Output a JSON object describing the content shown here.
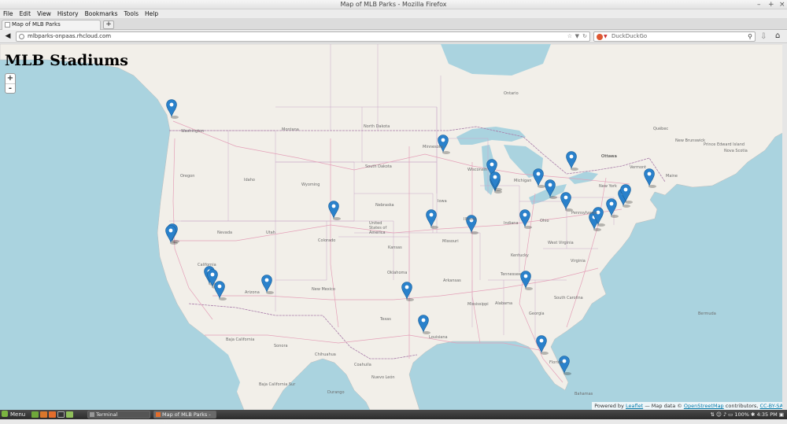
{
  "window": {
    "title": "Map of MLB Parks - Mozilla Firefox"
  },
  "menu": [
    "File",
    "Edit",
    "View",
    "History",
    "Bookmarks",
    "Tools",
    "Help"
  ],
  "tab": {
    "title": "Map of MLB Parks",
    "new_tab": "+"
  },
  "nav": {
    "url": "mlbparks-onpaas.rhcloud.com",
    "search_placeholder": "DuckDuckGo"
  },
  "page": {
    "title": "MLB Stadiums"
  },
  "zoom": {
    "in": "+",
    "out": "-"
  },
  "attribution": {
    "powered_by": "Powered by",
    "leaflet": "Leaflet",
    "sep": "— Map data ©",
    "osm": "OpenStreetMap",
    "contributors": "contributors,",
    "license": "CC-BY-SA"
  },
  "map_labels": [
    "Montana",
    "North Dakota",
    "South Dakota",
    "Wyoming",
    "Idaho",
    "Oregon",
    "Washington",
    "Nevada",
    "Utah",
    "Colorado",
    "Nebraska",
    "Kansas",
    "California",
    "Arizona",
    "New Mexico",
    "Texas",
    "Oklahoma",
    "Minnesota",
    "Wisconsin",
    "Iowa",
    "Missouri",
    "Arkansas",
    "Mississippi",
    "Alabama",
    "Tennessee",
    "Kentucky",
    "Indiana",
    "Ohio",
    "Michigan",
    "Pennsylvania",
    "New York",
    "Virginia",
    "South Carolina",
    "Georgia",
    "Florida",
    "Ontario",
    "Ottawa",
    "Québec",
    "Maine",
    "Vermont",
    "United States of America",
    "Sonora",
    "Chihuahua",
    "Coahuila",
    "Durango",
    "Nuevo León",
    "Baja California",
    "Baja California Sur",
    "Bermuda",
    "Bahamas",
    "New Brunswick",
    "Prince Edward Island",
    "Nova Scotia",
    "Louisiana",
    "Illinois",
    "West Virginia"
  ],
  "stadium_count": 30,
  "taskbar": {
    "menu": "Menu",
    "tasks": [
      "Terminal",
      "Map of MLB Parks - ..."
    ],
    "zoom_level": "100%",
    "clock": "4:35 PM"
  }
}
